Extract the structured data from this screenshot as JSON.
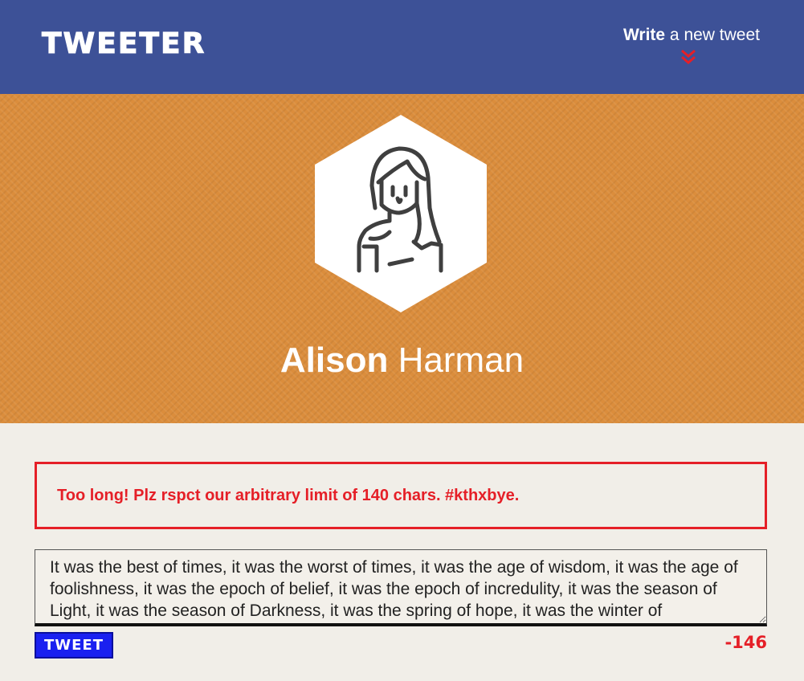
{
  "nav": {
    "logo": "TWEETER",
    "compose_bold": "Write",
    "compose_rest": " a new tweet",
    "chevron_icon": "double-chevron-down-icon",
    "chevron_color": "#e51f27"
  },
  "profile": {
    "first_name": "Alison",
    "last_name": " Harman",
    "avatar_icon": "woman-avatar-icon"
  },
  "error": {
    "message": "Too long! Plz rspct our arbitrary limit of 140 chars. #kthxbye."
  },
  "compose": {
    "text": "It was the best of times, it was the worst of times, it was the age of wisdom, it was the age of foolishness, it was the epoch of belief, it was the epoch of incredulity, it was the season of Light, it was the season of Darkness, it was the spring of hope, it was the winter of",
    "button_label": "TWEET",
    "counter": "-146"
  },
  "colors": {
    "nav_bg": "#3d5197",
    "hero_bg": "#db8d3c",
    "page_bg": "#f1eee8",
    "error": "#e51f27",
    "button_bg": "#1a20f0"
  }
}
